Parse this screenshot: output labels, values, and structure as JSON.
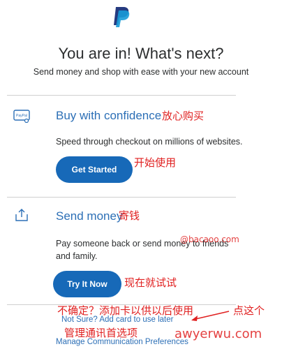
{
  "header": {
    "title": "You are in! What's next?",
    "subtitle": "Send money and shop with ease with your new account"
  },
  "sections": [
    {
      "icon": "paypal-card-icon",
      "title": "Buy with confidence",
      "description": "Speed through checkout on millions of websites.",
      "button_label": "Get Started",
      "title_annotation": "放心购买",
      "button_annotation": "开始使用"
    },
    {
      "icon": "send-money-icon",
      "title": "Send money",
      "description": "Pay someone back or send money to friends and family.",
      "button_label": "Try It Now",
      "title_annotation": "寄钱",
      "button_annotation": "现在就试试"
    }
  ],
  "footer": {
    "add_card_link": "Not Sure? Add card to use later",
    "manage_link": "Manage Communication Preferences",
    "add_card_annotation": "不确定？添加卡以供以后使用",
    "click_annotation": "点这个",
    "manage_annotation": "管理通讯首选项"
  },
  "watermarks": {
    "site_mark": "@bacaoo.com",
    "site_footer": "awyerwu.com"
  },
  "colors": {
    "brand_blue": "#1769b8",
    "link_blue": "#2c6fb6",
    "annotation_red": "#e02020"
  }
}
